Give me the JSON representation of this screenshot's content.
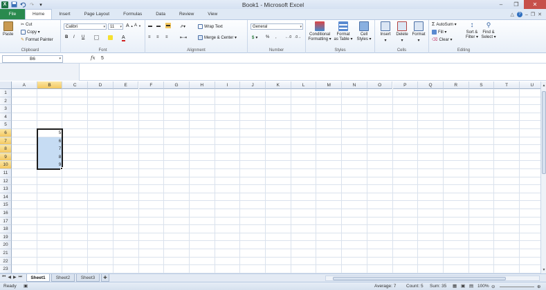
{
  "window": {
    "title": "Book1 - Microsoft Excel",
    "controls": [
      "–",
      "❐",
      "✕"
    ]
  },
  "tabs": {
    "file": "File",
    "items": [
      "Home",
      "Insert",
      "Page Layout",
      "Formulas",
      "Data",
      "Review",
      "View"
    ]
  },
  "ribbon": {
    "clipboard": {
      "label": "Clipboard",
      "paste": "Paste",
      "cut": "Cut",
      "copy": "Copy ▾",
      "format_painter": "Format Painter"
    },
    "font": {
      "label": "Font",
      "font_name": "Calibri",
      "font_size": "11",
      "bold": "B",
      "italic": "I",
      "underline": "U"
    },
    "alignment": {
      "label": "Alignment",
      "wrap_text": "Wrap Text",
      "merge_center": "Merge & Center ▾"
    },
    "number": {
      "label": "Number",
      "format": "General",
      "currency": "$",
      "percent": "%",
      "comma": ","
    },
    "styles": {
      "label": "Styles",
      "conditional": "Conditional\nFormatting ▾",
      "format_table": "Format\nas Table ▾",
      "cell_styles": "Cell\nStyles ▾"
    },
    "cells": {
      "label": "Cells",
      "insert": "Insert",
      "delete": "Delete",
      "format": "Format"
    },
    "editing": {
      "label": "Editing",
      "autosum": "AutoSum ▾",
      "fill": "Fill ▾",
      "clear": "Clear ▾",
      "sort_filter": "Sort &\nFilter ▾",
      "find_select": "Find &\nSelect ▾"
    }
  },
  "formula_bar": {
    "name_box": "B6",
    "fx": "fx",
    "value": "5"
  },
  "grid": {
    "columns": [
      "A",
      "B",
      "C",
      "D",
      "E",
      "F",
      "G",
      "H",
      "I",
      "J",
      "K",
      "L",
      "M",
      "N",
      "O",
      "P",
      "Q",
      "R",
      "S",
      "T",
      "U"
    ],
    "rows": [
      "1",
      "2",
      "3",
      "4",
      "5",
      "6",
      "7",
      "8",
      "9",
      "10",
      "11",
      "12",
      "13",
      "14",
      "15",
      "16",
      "17",
      "18",
      "19",
      "20",
      "21",
      "22",
      "23"
    ],
    "selected_column": "B",
    "selected_rows": [
      "6",
      "7",
      "8",
      "9",
      "10"
    ],
    "cells": [
      {
        "ref": "B6",
        "value": "5"
      },
      {
        "ref": "B7",
        "value": "6"
      },
      {
        "ref": "B8",
        "value": "7"
      },
      {
        "ref": "B9",
        "value": "8"
      },
      {
        "ref": "B10",
        "value": "9"
      }
    ]
  },
  "sheets": {
    "tabs": [
      "Sheet1",
      "Sheet2",
      "Sheet3"
    ],
    "active": "Sheet1"
  },
  "status": {
    "mode": "Ready",
    "average": "Average: 7",
    "count": "Count: 5",
    "sum": "Sum: 35",
    "zoom": "100%"
  }
}
